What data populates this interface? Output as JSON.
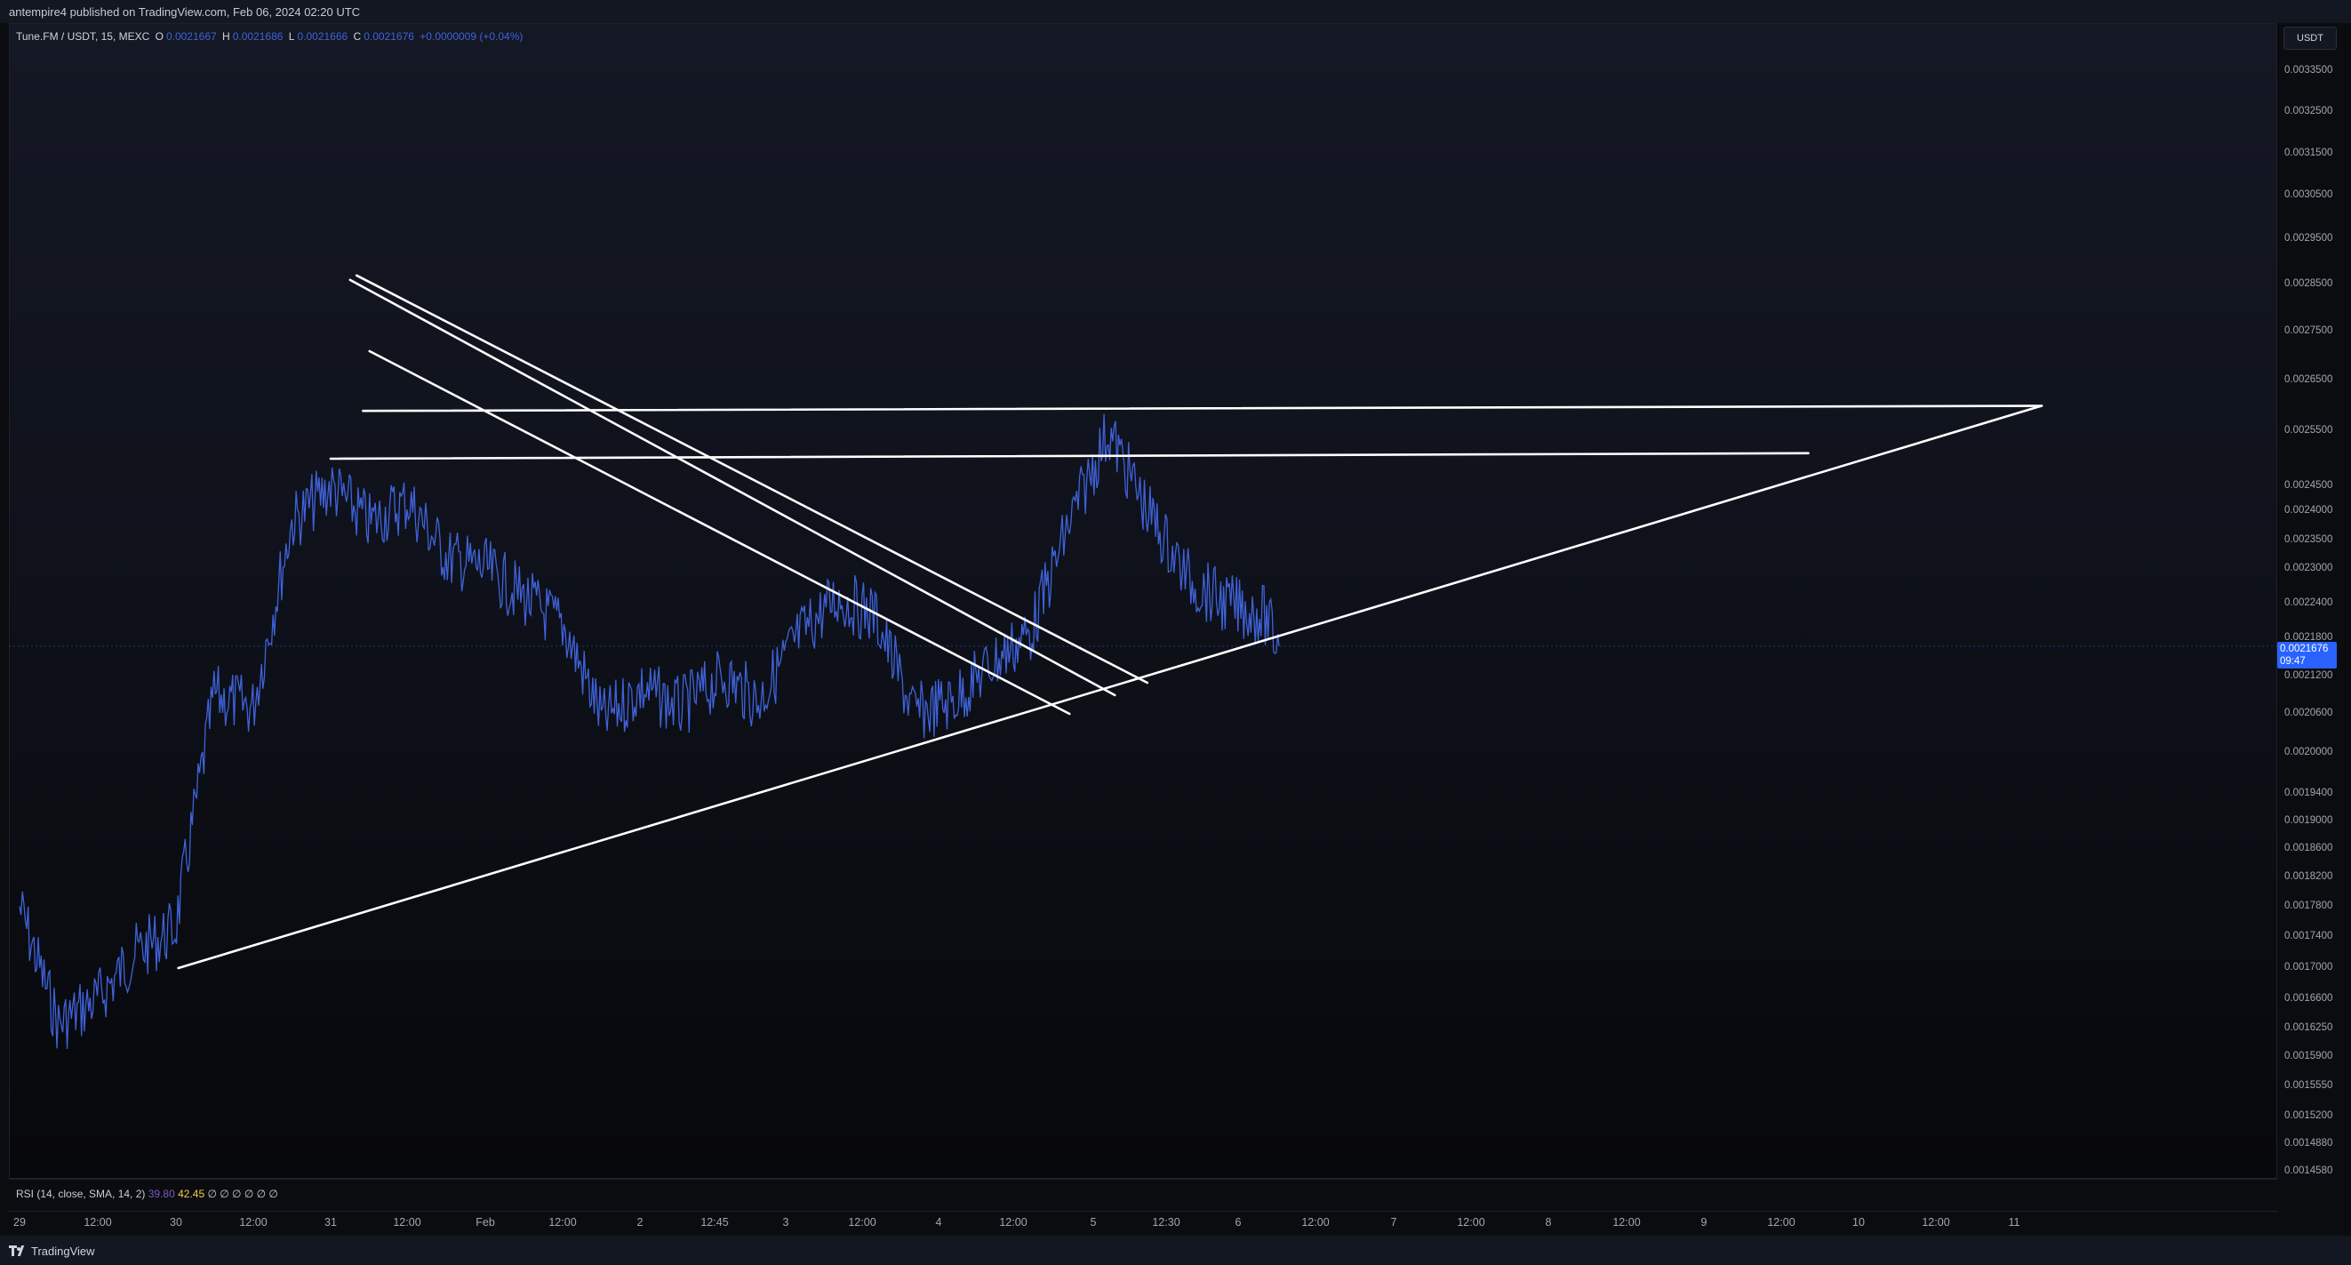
{
  "header": {
    "published_text": "antempire4 published on TradingView.com, Feb 06, 2024 02:20 UTC"
  },
  "legend": {
    "symbol": "Tune.FM / USDT, 15, MEXC",
    "open_key": "O",
    "open_val": "0.0021667",
    "high_key": "H",
    "high_val": "0.0021686",
    "low_key": "L",
    "low_val": "0.0021666",
    "close_key": "C",
    "close_val": "0.0021676",
    "change": "+0.0000009 (+0.04%)"
  },
  "price_axis": {
    "currency": "USDT",
    "labels": [
      "0.0033500",
      "0.0032500",
      "0.0031500",
      "0.0030500",
      "0.0029500",
      "0.0028500",
      "0.0027500",
      "0.0026500",
      "0.0025500",
      "0.0024500",
      "0.0024000",
      "0.0023500",
      "0.0023000",
      "0.0022400",
      "0.0021800",
      "0.0021200",
      "0.0020600",
      "0.0020000",
      "0.0019400",
      "0.0019000",
      "0.0018600",
      "0.0018200",
      "0.0017800",
      "0.0017400",
      "0.0017000",
      "0.0016600",
      "0.0016250",
      "0.0015900",
      "0.0015550",
      "0.0015200",
      "0.0014880",
      "0.0014580"
    ],
    "current_price": "0.0021676",
    "countdown": "09:47"
  },
  "rsi": {
    "title": "RSI (14, close, SMA, 14, 2)",
    "value_rsi": "39.80",
    "value_ma": "42.45",
    "nulls": "∅ ∅ ∅ ∅ ∅ ∅"
  },
  "time_axis": {
    "labels": [
      "29",
      "12:00",
      "30",
      "12:00",
      "31",
      "12:00",
      "Feb",
      "12:00",
      "2",
      "12:45",
      "3",
      "12:00",
      "4",
      "12:00",
      "5",
      "12:30",
      "6",
      "12:00",
      "7",
      "12:00",
      "8",
      "12:00",
      "9",
      "12:00",
      "10",
      "12:00",
      "11"
    ]
  },
  "footer": {
    "brand": "TradingView"
  },
  "colors": {
    "candle": "#3f62d9",
    "trendline": "#ffffff",
    "price_tag": "#2962ff",
    "rsi": "#7e57c2",
    "rsi_ma": "#f7c948"
  },
  "chart_data": {
    "type": "line",
    "title": "Tune.FM / USDT, 15, MEXC",
    "xlabel": "",
    "ylabel": "",
    "ylim": [
      0.001458,
      0.00335
    ],
    "x_range": [
      "Jan 29 2024",
      "Feb 11 2024"
    ],
    "series": [
      {
        "x": [
          "Jan 29 00:00",
          "Jan 29 06:00",
          "Jan 29 12:00",
          "Jan 29 18:00",
          "Jan 30 00:00",
          "Jan 30 06:00",
          "Jan 30 12:00",
          "Jan 30 18:00",
          "Jan 31 00:00",
          "Jan 31 06:00",
          "Jan 31 12:00",
          "Jan 31 18:00",
          "Feb 1 00:00",
          "Feb 1 06:00",
          "Feb 1 12:00",
          "Feb 1 18:00",
          "Feb 2 00:00",
          "Feb 2 06:00",
          "Feb 2 12:45",
          "Feb 2 18:00",
          "Feb 3 00:00",
          "Feb 3 06:00",
          "Feb 3 12:00",
          "Feb 3 18:00",
          "Feb 4 00:00",
          "Feb 4 06:00",
          "Feb 4 12:00",
          "Feb 4 18:00",
          "Feb 5 00:00",
          "Feb 5 06:00",
          "Feb 5 12:30",
          "Feb 5 18:00",
          "Feb 6 00:00",
          "Feb 6 02:20"
        ],
        "values": [
          0.00178,
          0.00163,
          0.00166,
          0.00172,
          0.00175,
          0.00209,
          0.00207,
          0.00238,
          0.00245,
          0.00238,
          0.00242,
          0.00232,
          0.0023,
          0.00225,
          0.0022,
          0.00205,
          0.0021,
          0.00207,
          0.00212,
          0.00208,
          0.00218,
          0.00225,
          0.00222,
          0.00206,
          0.00208,
          0.00214,
          0.00219,
          0.00238,
          0.00255,
          0.0024,
          0.00228,
          0.00224,
          0.00222,
          0.0021676
        ]
      }
    ],
    "trendlines": [
      {
        "from": [
          "Jan 30 00:30",
          0.0017
        ],
        "to": [
          "Feb 11 00:00",
          0.0026
        ]
      },
      {
        "from": [
          "Jan 31 05:00",
          0.00259
        ],
        "to": [
          "Feb 11 00:00",
          0.0026
        ]
      },
      {
        "from": [
          "Jan 31 00:00",
          0.0025
        ],
        "to": [
          "Feb 9 12:00",
          0.00251
        ]
      },
      {
        "from": [
          "Jan 31 03:00",
          0.00286
        ],
        "to": [
          "Feb 5 01:00",
          0.00209
        ]
      },
      {
        "from": [
          "Jan 31 04:00",
          0.00287
        ],
        "to": [
          "Feb 5 06:00",
          0.00211
        ]
      },
      {
        "from": [
          "Jan 31 06:00",
          0.00271
        ],
        "to": [
          "Feb 4 18:00",
          0.00206
        ]
      }
    ]
  }
}
